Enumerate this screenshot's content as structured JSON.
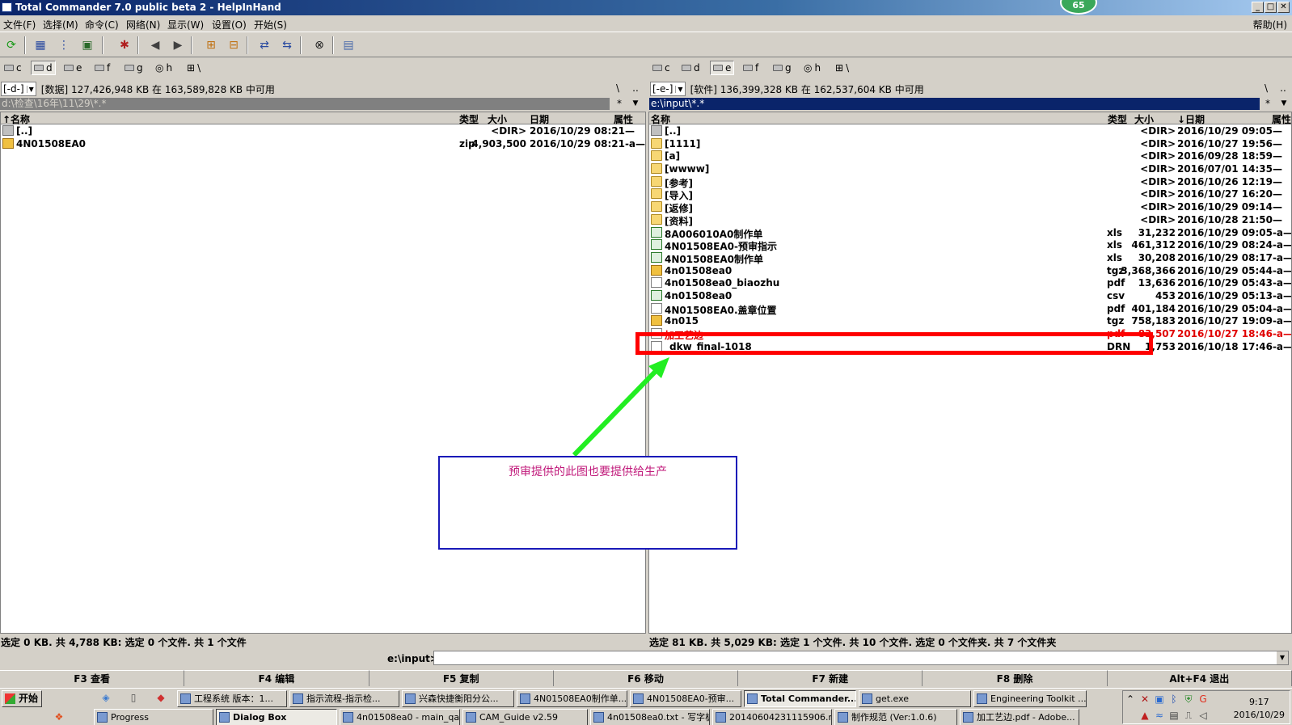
{
  "titlebar": {
    "title": "Total Commander 7.0 public beta 2 - HelpInHand",
    "badge": "65",
    "min": "_",
    "max": "□",
    "close": "✕"
  },
  "menu": {
    "items": [
      "文件(F)",
      "选择(M)",
      "命令(C)",
      "网络(N)",
      "显示(W)",
      "设置(O)",
      "开始(S)"
    ],
    "help": "帮助(H)"
  },
  "drives": {
    "left": [
      "c",
      "d",
      "e",
      "f",
      "g",
      "h",
      "\\"
    ],
    "right": [
      "c",
      "d",
      "e",
      "f",
      "g",
      "h",
      "\\"
    ]
  },
  "left": {
    "drive_select": "[-d-]",
    "info": "[数据]  127,426,948 KB 在 163,589,828 KB 中可用",
    "path": "d:\\检查\\16年\\11\\29\\*.*",
    "headers": {
      "name": "↑名称",
      "type": "类型",
      "size": "大小",
      "date": "日期",
      "attr": "属性"
    },
    "rows": [
      {
        "icon": "up",
        "name": "[..]",
        "type": "",
        "size": "<DIR>",
        "date": "2016/10/29 08:21—"
      },
      {
        "icon": "zip",
        "name": "4N01508EA0",
        "type": "zip",
        "size": "4,903,500",
        "date": "2016/10/29 08:21-a—"
      }
    ],
    "status": "选定 0 KB. 共 4,788 KB: 选定 0 个文件. 共 1 个文件"
  },
  "right": {
    "drive_select": "[-e-]",
    "info": "[软件]  136,399,328 KB 在 162,537,604 KB 中可用",
    "path": "e:\\input\\*.*",
    "headers": {
      "name": "名称",
      "type": "类型",
      "size": "大小",
      "date": "↓日期",
      "attr": "属性"
    },
    "rows": [
      {
        "icon": "up",
        "name": "[..]",
        "type": "",
        "size": "<DIR>",
        "date": "2016/10/29 09:05—"
      },
      {
        "icon": "folder",
        "name": "[1111]",
        "type": "",
        "size": "<DIR>",
        "date": "2016/10/27 19:56—"
      },
      {
        "icon": "folder",
        "name": "[a]",
        "type": "",
        "size": "<DIR>",
        "date": "2016/09/28 18:59—"
      },
      {
        "icon": "folder",
        "name": "[wwww]",
        "type": "",
        "size": "<DIR>",
        "date": "2016/07/01 14:35—"
      },
      {
        "icon": "folder",
        "name": "[参考]",
        "type": "",
        "size": "<DIR>",
        "date": "2016/10/26 12:19—"
      },
      {
        "icon": "folder",
        "name": "[导入]",
        "type": "",
        "size": "<DIR>",
        "date": "2016/10/27 16:20—"
      },
      {
        "icon": "folder",
        "name": "[返修]",
        "type": "",
        "size": "<DIR>",
        "date": "2016/10/29 09:14—"
      },
      {
        "icon": "folder",
        "name": "[资料]",
        "type": "",
        "size": "<DIR>",
        "date": "2016/10/28 21:50—"
      },
      {
        "icon": "xls",
        "name": "8A006010A0制作单",
        "type": "xls",
        "size": "31,232",
        "date": "2016/10/29 09:05-a—"
      },
      {
        "icon": "xls",
        "name": "4N01508EA0-预审指示",
        "type": "xls",
        "size": "461,312",
        "date": "2016/10/29 08:24-a—"
      },
      {
        "icon": "xls",
        "name": "4N01508EA0制作单",
        "type": "xls",
        "size": "30,208",
        "date": "2016/10/29 08:17-a—"
      },
      {
        "icon": "zip",
        "name": "4n01508ea0",
        "type": "tgz",
        "size": "3,368,366",
        "date": "2016/10/29 05:44-a—"
      },
      {
        "icon": "doc",
        "name": "4n01508ea0_biaozhu",
        "type": "pdf",
        "size": "13,636",
        "date": "2016/10/29 05:43-a—"
      },
      {
        "icon": "xls",
        "name": "4n01508ea0",
        "type": "csv",
        "size": "453",
        "date": "2016/10/29 05:13-a—"
      },
      {
        "icon": "doc",
        "name": "4N01508EA0.盖章位置",
        "type": "pdf",
        "size": "401,184",
        "date": "2016/10/29 05:04-a—"
      },
      {
        "icon": "zip",
        "name": "4n015",
        "type": "tgz",
        "size": "758,183",
        "date": "2016/10/27 19:09-a—"
      },
      {
        "icon": "doc",
        "name": "加工艺边",
        "type": "pdf",
        "size": "83,507",
        "date": "2016/10/27 18:46-a—",
        "selected": true
      },
      {
        "icon": "doc",
        "name": "_dkw_final-1018",
        "type": "DRN",
        "size": "1,753",
        "date": "2016/10/18 17:46-a—"
      }
    ],
    "status": "选定 81 KB. 共 5,029 KB: 选定 1 个文件. 共 10 个文件. 选定 0 个文件夹. 共 7 个文件夹"
  },
  "annotation": {
    "text": "预审提供的此图也要提供给生产",
    "box_color": "#1a1ab8",
    "text_color": "#c0187a",
    "highlight_color": "#ff0000",
    "arrow_color": "#22ee22"
  },
  "cmdline": {
    "label": "e:\\input>",
    "value": ""
  },
  "fkeys": [
    "F3 查看",
    "F4 编辑",
    "F5 复制",
    "F6 移动",
    "F7 新建",
    "F8 删除",
    "Alt+F4 退出"
  ],
  "taskbar": {
    "start": "开始",
    "row1": [
      "工程系统   版本：1...",
      "指示流程-指示检...",
      "兴森快捷衡阳分公...",
      "4N01508EA0制作单...",
      "4N01508EA0-预审...",
      "Total Commander...",
      "get.exe",
      "Engineering Toolkit ..."
    ],
    "row2": [
      "Progress",
      "Dialog Box",
      "4n01508ea0 - main_qa",
      "CAM_Guide v2.59",
      "4n01508ea0.txt - 写字板",
      "20140604231115906.r...",
      "制作规范 (Ver:1.0.6)",
      "加工艺边.pdf - Adobe..."
    ],
    "time": "9:17",
    "date": "2016/10/29"
  }
}
